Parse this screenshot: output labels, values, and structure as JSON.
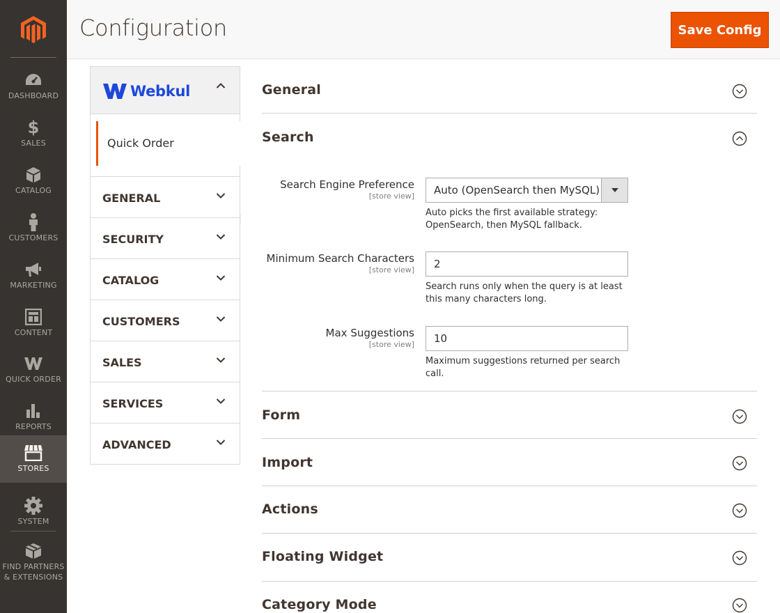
{
  "admin_menu": {
    "items": [
      {
        "label": "Dashboard",
        "icon": "dashboard-icon"
      },
      {
        "label": "Sales",
        "icon": "dollar-icon"
      },
      {
        "label": "Catalog",
        "icon": "cube-icon"
      },
      {
        "label": "Customers",
        "icon": "person-icon"
      },
      {
        "label": "Marketing",
        "icon": "megaphone-icon"
      },
      {
        "label": "Content",
        "icon": "layout-icon"
      },
      {
        "label": "Quick Order",
        "icon": "webkul-w-icon"
      },
      {
        "label": "Reports",
        "icon": "bar-chart-icon"
      },
      {
        "label": "Stores",
        "icon": "store-icon",
        "active": true
      },
      {
        "label": "System",
        "icon": "gear-icon"
      }
    ],
    "extensions_line1": "Find Partners",
    "extensions_line2": "& Extensions"
  },
  "header": {
    "title": "Configuration",
    "save_label": "Save Config"
  },
  "colors": {
    "accent": "#eb5202",
    "menu_bg": "#373330",
    "brand": "#1d48d9"
  },
  "tabs": {
    "brand_name": "Webkul",
    "active_subitem": "Quick Order",
    "items": [
      "General",
      "Security",
      "Catalog",
      "Customers",
      "Sales",
      "Services",
      "Advanced"
    ]
  },
  "sections": {
    "general": "General",
    "search": "Search",
    "form": "Form",
    "import": "Import",
    "actions": "Actions",
    "floating_widget": "Floating Widget",
    "category_mode": "Category Mode"
  },
  "search_fields": {
    "engine": {
      "label": "Search Engine Preference",
      "scope": "[store view]",
      "value": "Auto (OpenSearch then MySQL)",
      "note": "Auto picks the first available strategy: OpenSearch, then MySQL fallback."
    },
    "min_chars": {
      "label": "Minimum Search Characters",
      "scope": "[store view]",
      "value": "2",
      "note": "Search runs only when the query is at least this many characters long."
    },
    "max_suggestions": {
      "label": "Max Suggestions",
      "scope": "[store view]",
      "value": "10",
      "note": "Maximum suggestions returned per search call."
    }
  }
}
